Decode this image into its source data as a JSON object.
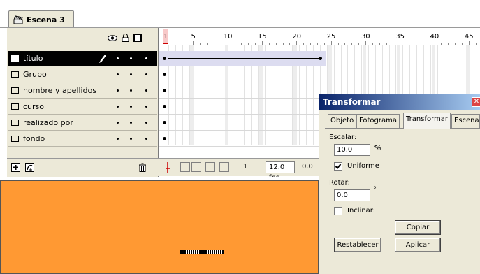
{
  "scene": {
    "tab_label": "Escena 3"
  },
  "timeline": {
    "layers": [
      {
        "name": "título",
        "active": true
      },
      {
        "name": "Grupo",
        "active": false
      },
      {
        "name": "nombre y apellidos",
        "active": false
      },
      {
        "name": "curso",
        "active": false
      },
      {
        "name": "realizado por",
        "active": false
      },
      {
        "name": "fondo",
        "active": false
      }
    ],
    "ruler_numbers": [
      "1",
      "5",
      "10",
      "15",
      "20",
      "25",
      "30",
      "35",
      "40",
      "45"
    ],
    "current_frame": "1",
    "frame_rate": "12.0 fps",
    "elapsed": "0.0"
  },
  "transform_panel": {
    "title": "Transformar",
    "tabs": [
      "Objeto",
      "Fotograma",
      "Transformar",
      "Escena"
    ],
    "selected_tab": "Transformar",
    "scale_label": "Escalar:",
    "scale_value": "10.0",
    "scale_unit": "%",
    "uniform_label": "Uniforme",
    "uniform_checked": true,
    "rotate_label": "Rotar:",
    "rotate_value": "0.0",
    "rotate_unit": "°",
    "skew_label": "Inclinar:",
    "skew_checked": false,
    "copy_button": "Copiar",
    "reset_button": "Restablecer",
    "apply_button": "Aplicar"
  },
  "colors": {
    "stage": "#ff9933",
    "title_bar": "#0a246a",
    "panel_bg": "#ece9d8"
  }
}
